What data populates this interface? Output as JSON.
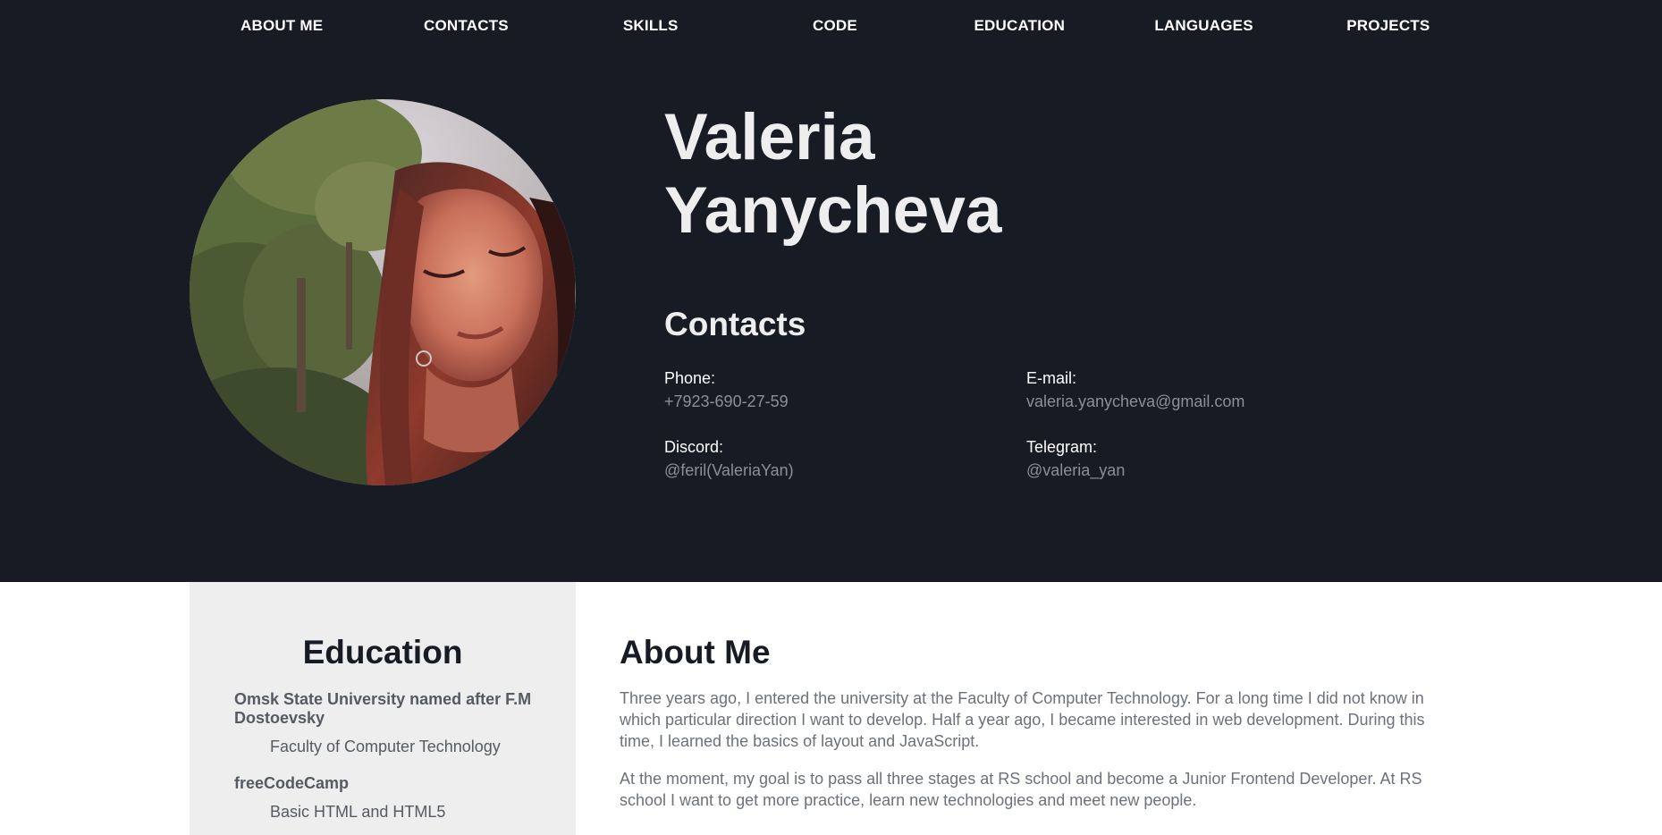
{
  "nav": [
    {
      "label": "ABOUT ME"
    },
    {
      "label": "CONTACTS"
    },
    {
      "label": "SKILLS"
    },
    {
      "label": "CODE"
    },
    {
      "label": "EDUCATION"
    },
    {
      "label": "LANGUAGES"
    },
    {
      "label": "PROJECTS"
    }
  ],
  "profile": {
    "first_name": "Valeria",
    "last_name": "Yanycheva"
  },
  "contacts": {
    "title": "Contacts",
    "phone": {
      "label": "Phone:",
      "value": "+7923-690-27-59"
    },
    "email": {
      "label": "E-mail:",
      "value": "valeria.yanycheva@gmail.com"
    },
    "discord": {
      "label": "Discord:",
      "value": "@feril(ValeriaYan)"
    },
    "telegram": {
      "label": "Telegram:",
      "value": "@valeria_yan"
    }
  },
  "education": {
    "title": "Education",
    "items": [
      {
        "school": "Omsk State University named after F.M Dostoevsky",
        "detail": "Faculty of Computer Technology"
      },
      {
        "school": "freeCodeCamp",
        "detail": "Basic HTML and HTML5"
      }
    ]
  },
  "about": {
    "title": "About Me",
    "paragraphs": [
      "Three years ago, I entered the university at the Faculty of Computer Technology. For a long time I did not know in which particular direction I want to develop. Half a year ago, I became interested in web development. During this time, I learned the basics of layout and JavaScript.",
      "At the moment, my goal is to pass all three stages at RS school and become a Junior Frontend Developer. At RS school I want to get more practice, learn new technologies and meet new people."
    ]
  },
  "colors": {
    "hero_bg": "#171b24",
    "sidebar_bg": "#eeeeee",
    "muted_text": "#8a8f99"
  }
}
